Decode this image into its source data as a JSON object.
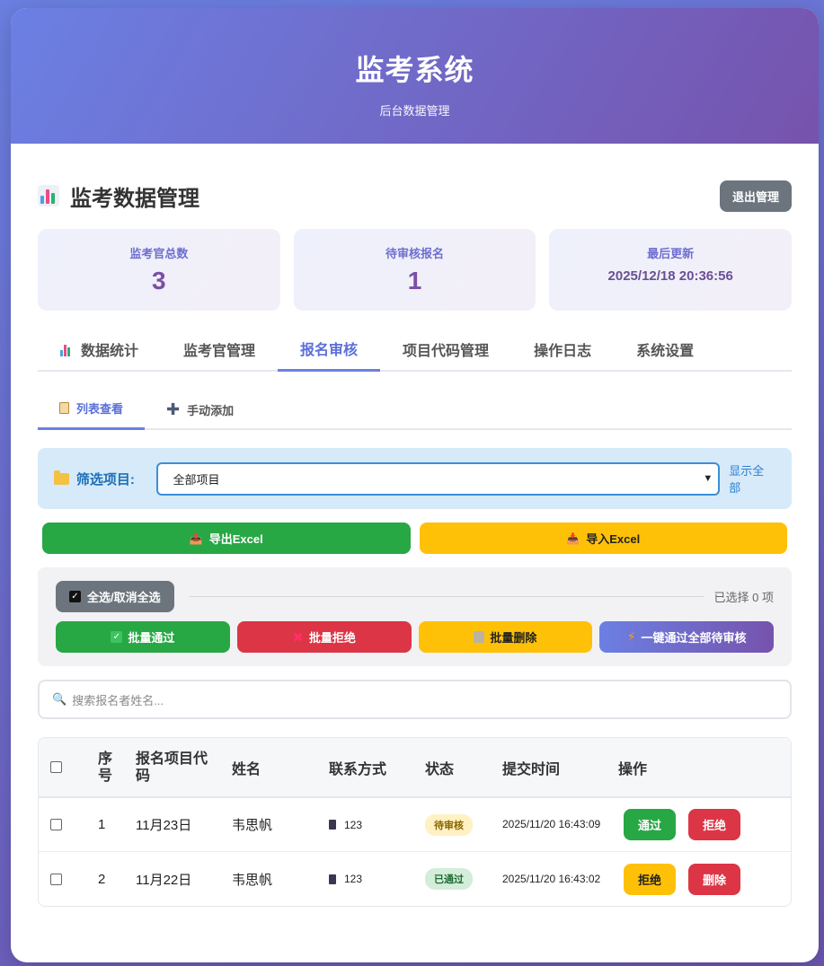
{
  "header": {
    "title": "监考系统",
    "subtitle": "后台数据管理"
  },
  "page": {
    "title": "监考数据管理",
    "logout_label": "退出管理"
  },
  "stats": [
    {
      "label": "监考官总数",
      "value": "3"
    },
    {
      "label": "待审核报名",
      "value": "1"
    },
    {
      "label": "最后更新",
      "value": "2025/12/18 20:36:56"
    }
  ],
  "tabs": [
    {
      "label": "数据统计"
    },
    {
      "label": "监考官管理"
    },
    {
      "label": "报名审核"
    },
    {
      "label": "项目代码管理"
    },
    {
      "label": "操作日志"
    },
    {
      "label": "系统设置"
    }
  ],
  "subtabs": [
    {
      "label": "列表查看"
    },
    {
      "label": "手动添加"
    }
  ],
  "filter": {
    "label": "筛选项目:",
    "selected": "全部项目",
    "show_all": "显示全部"
  },
  "io": {
    "export_label": "导出Excel",
    "import_label": "导入Excel"
  },
  "batch": {
    "select_all_label": "全选/取消全选",
    "selected_count": "已选择 0 项",
    "approve_label": "批量通过",
    "reject_label": "批量拒绝",
    "delete_label": "批量删除",
    "approve_all_label": "一键通过全部待审核"
  },
  "search": {
    "placeholder": "搜索报名者姓名..."
  },
  "table": {
    "headers": [
      "序号",
      "报名项目代码",
      "姓名",
      "联系方式",
      "状态",
      "提交时间",
      "操作"
    ],
    "rows": [
      {
        "index": "1",
        "code": "11月23日",
        "name": "韦思帆",
        "contact": "123",
        "status": "待审核",
        "time": "2025/11/20 16:43:09",
        "actions": [
          "通过",
          "拒绝"
        ]
      },
      {
        "index": "2",
        "code": "11月22日",
        "name": "韦思帆",
        "contact": "123",
        "status": "已通过",
        "time": "2025/11/20 16:43:02",
        "actions": [
          "拒绝",
          "删除"
        ]
      }
    ]
  },
  "colors": {
    "accent": "#6b80e3",
    "accent_dark": "#7653ad",
    "success": "#28a745",
    "danger": "#dc3545",
    "warning": "#ffc107",
    "neutral": "#6c757d"
  }
}
